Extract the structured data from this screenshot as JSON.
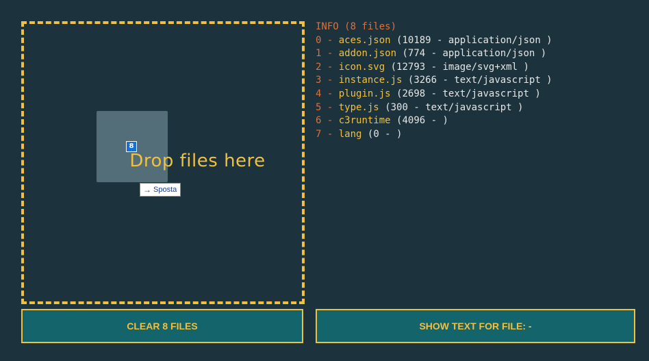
{
  "drop_zone": {
    "label": "Drop files here",
    "drag_count": "8",
    "tooltip_label": "Sposta",
    "border_color": "#f0c040"
  },
  "info": {
    "title": "INFO (8 files)",
    "files": [
      {
        "index": "0",
        "name": "aces.json",
        "meta": "(10189 - application/json )"
      },
      {
        "index": "1",
        "name": "addon.json",
        "meta": "(774 - application/json )"
      },
      {
        "index": "2",
        "name": "icon.svg",
        "meta": "(12793 - image/svg+xml )"
      },
      {
        "index": "3",
        "name": "instance.js",
        "meta": "(3266 - text/javascript )"
      },
      {
        "index": "4",
        "name": "plugin.js",
        "meta": "(2698 - text/javascript )"
      },
      {
        "index": "5",
        "name": "type.js",
        "meta": "(300 - text/javascript )"
      },
      {
        "index": "6",
        "name": "c3runtime",
        "meta": "(4096 -  )"
      },
      {
        "index": "7",
        "name": "lang",
        "meta": "(0 -  )"
      }
    ]
  },
  "buttons": {
    "clear_label": "CLEAR 8 FILES",
    "show_label": "SHOW TEXT FOR FILE: -"
  },
  "colors": {
    "background": "#1c323c",
    "accent": "#f0c040",
    "orange": "#e0703a",
    "button_bg": "#14646c"
  },
  "icons": {
    "tooltip_icon": "arrow-right-icon"
  }
}
